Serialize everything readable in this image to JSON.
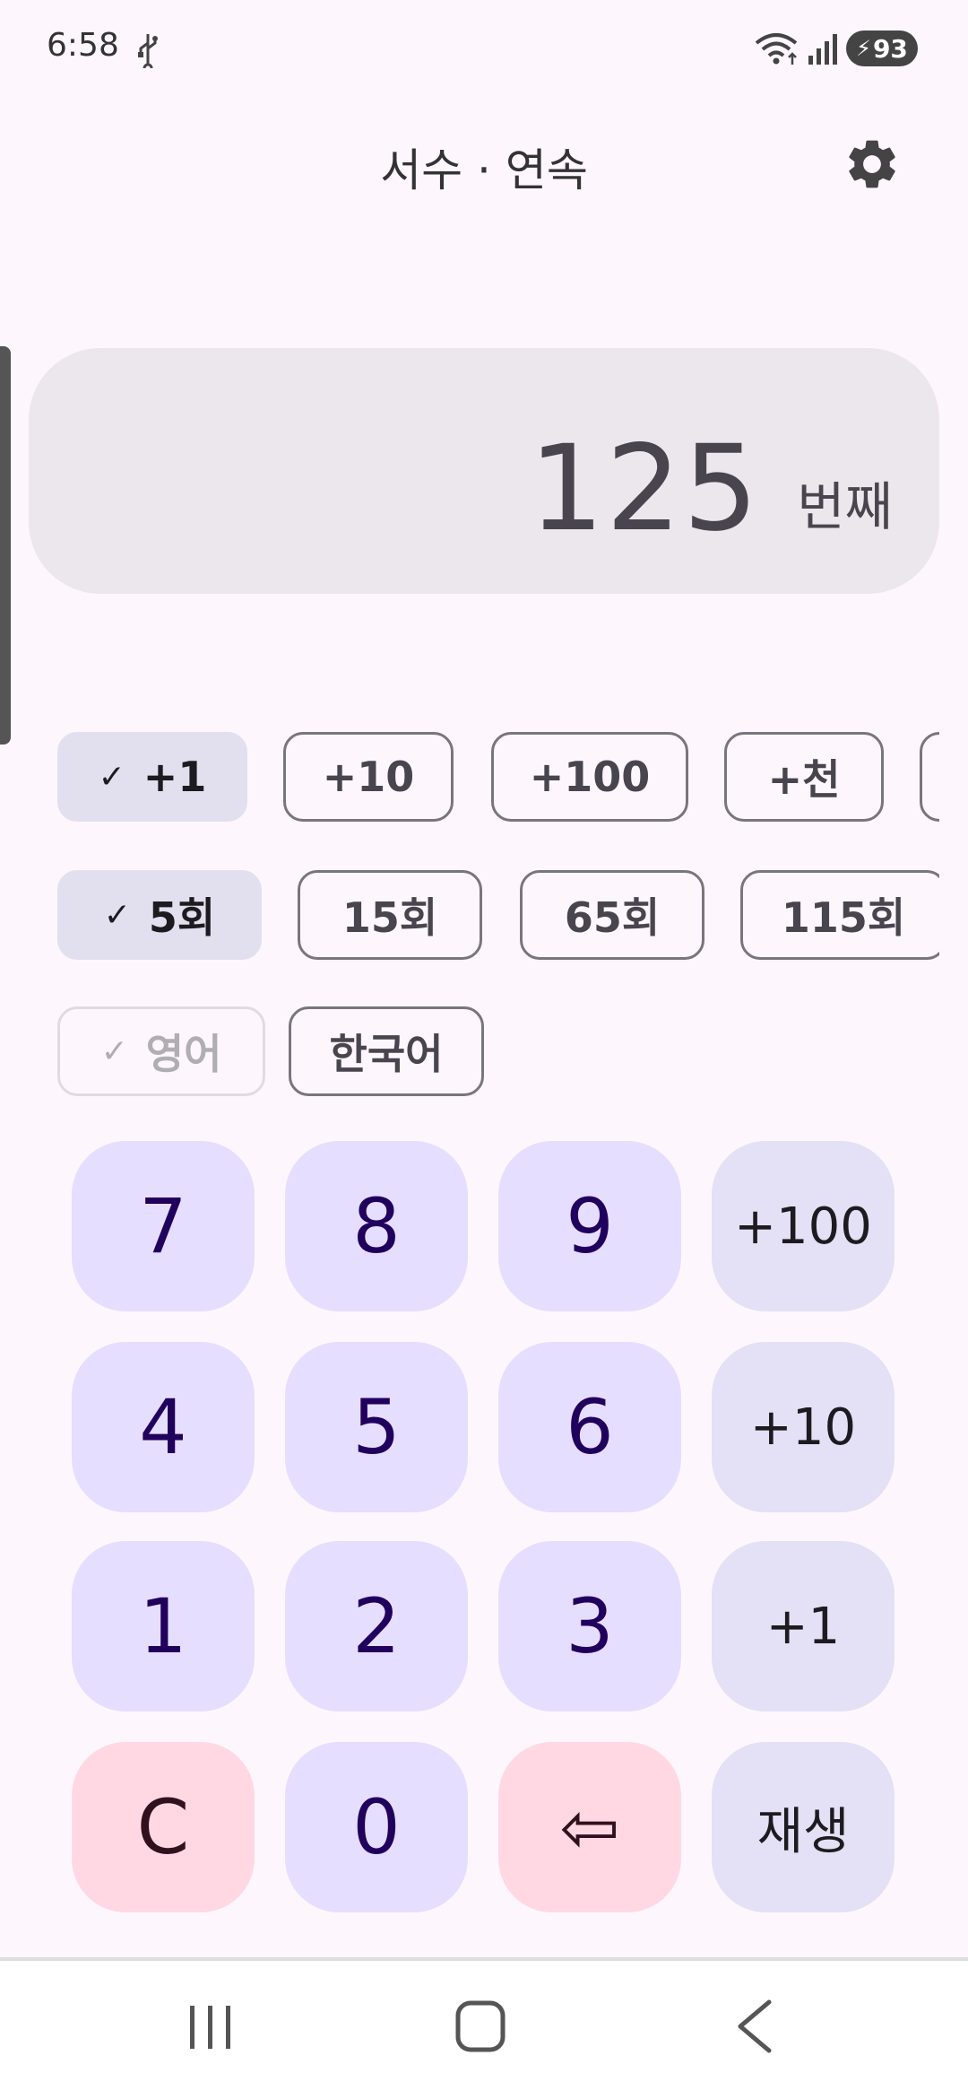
{
  "status": {
    "time": "6:58",
    "battery": "93"
  },
  "header": {
    "title": "서수 · 연속"
  },
  "display": {
    "value": "125",
    "unit": "번째"
  },
  "step_chips": [
    {
      "label": "+1",
      "selected": true
    },
    {
      "label": "+10",
      "selected": false
    },
    {
      "label": "+100",
      "selected": false
    },
    {
      "label": "+천",
      "selected": false
    }
  ],
  "repeat_chips": [
    {
      "label": "5회",
      "selected": true
    },
    {
      "label": "15회",
      "selected": false
    },
    {
      "label": "65회",
      "selected": false
    },
    {
      "label": "115회",
      "selected": false
    }
  ],
  "language_chips": [
    {
      "label": "영어",
      "selected": true,
      "disabled": true
    },
    {
      "label": "한국어",
      "selected": false
    }
  ],
  "keypad": {
    "k7": "7",
    "k8": "8",
    "k9": "9",
    "plus100": "+100",
    "k4": "4",
    "k5": "5",
    "k6": "6",
    "plus10": "+10",
    "k1": "1",
    "k2": "2",
    "k3": "3",
    "plus1": "+1",
    "clear": "C",
    "k0": "0",
    "backspace": "⇦",
    "play": "재생"
  },
  "colors": {
    "background": "#fdf7fd",
    "key_number": "#e5deff",
    "key_op": "#e4e0f5",
    "key_danger": "#ffd8e4",
    "chip_selected": "#e2dfef"
  }
}
